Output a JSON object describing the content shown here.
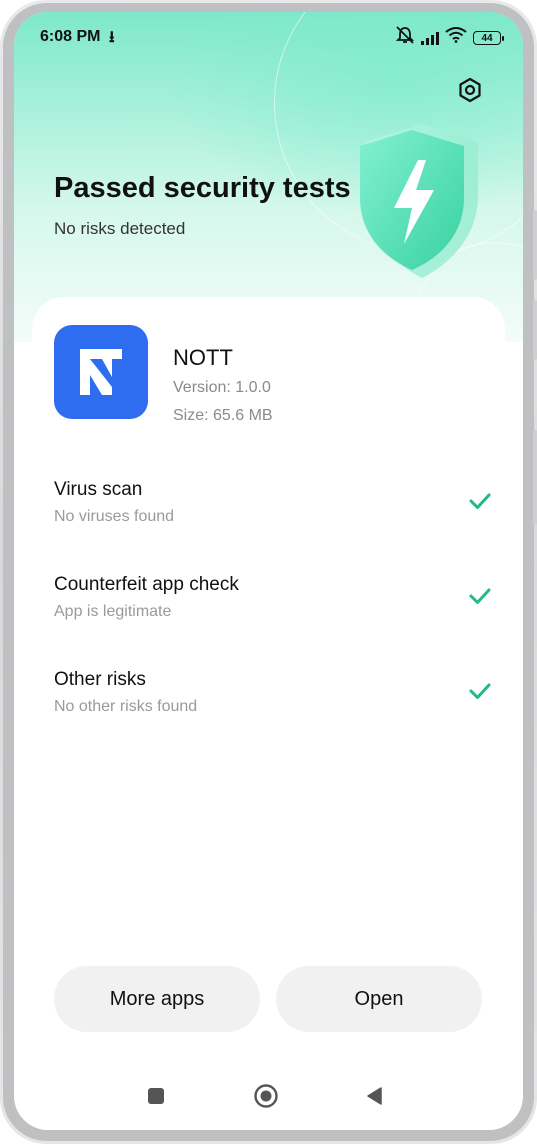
{
  "status_bar": {
    "time": "6:08 PM",
    "download_indicator": "⭳",
    "battery": "44",
    "icons": [
      "mute-icon",
      "signal-icon",
      "wifi-icon",
      "battery-icon"
    ]
  },
  "header": {
    "title": "Passed security tests",
    "subtitle": "No risks detected",
    "settings_icon": "hexagon-settings-icon",
    "shield_icon": "shield-lightning-icon"
  },
  "app": {
    "name": "NOTT",
    "version": "Version: 1.0.0",
    "size": "Size: 65.6 MB",
    "icon_color": "#2f6df0"
  },
  "checks": [
    {
      "title": "Virus scan",
      "subtitle": "No viruses found",
      "status": "passed"
    },
    {
      "title": "Counterfeit app check",
      "subtitle": "App is legitimate",
      "status": "passed"
    },
    {
      "title": "Other risks",
      "subtitle": "No other risks found",
      "status": "passed"
    }
  ],
  "actions": {
    "more_apps": "More apps",
    "open": "Open"
  },
  "colors": {
    "accent": "#1fb98a",
    "app_icon": "#2f6df0"
  },
  "navigation": [
    "recents-square-icon",
    "home-circle-icon",
    "back-triangle-icon"
  ]
}
